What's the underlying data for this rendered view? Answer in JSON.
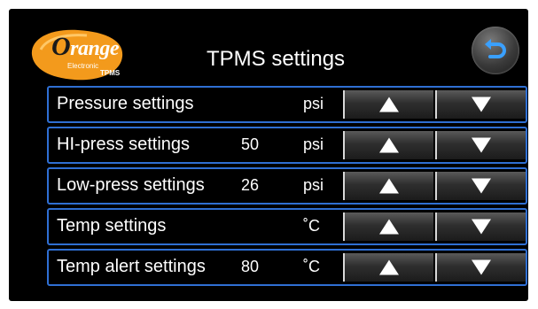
{
  "header": {
    "logo": {
      "word": "range",
      "first_letter": "O",
      "sub": "Electronic",
      "badge": "TPMS"
    },
    "title": "TPMS settings",
    "back_icon": "return-arrow-icon"
  },
  "rows": [
    {
      "label": "Pressure settings",
      "value": "",
      "unit": "psi"
    },
    {
      "label": "HI-press settings",
      "value": "50",
      "unit": "psi"
    },
    {
      "label": "Low-press settings",
      "value": "26",
      "unit": "psi"
    },
    {
      "label": "Temp settings",
      "value": "",
      "unit": "˚C"
    },
    {
      "label": "Temp alert settings",
      "value": "80",
      "unit": "˚C"
    }
  ],
  "colors": {
    "accent_border": "#2f6fd3",
    "logo_orange": "#f39a1c",
    "background": "#000000"
  }
}
